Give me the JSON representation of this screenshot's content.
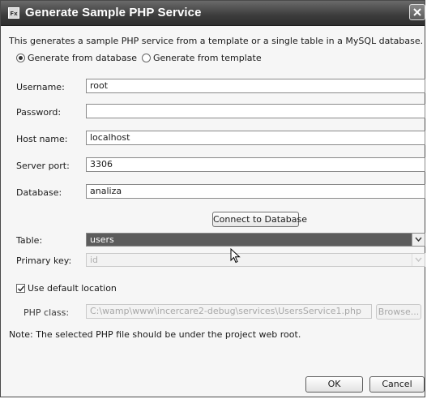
{
  "window": {
    "title": "Generate Sample PHP Service",
    "app_icon_text": "Fx"
  },
  "description": "This generates a sample PHP service from a template or a single table in a MySQL database.",
  "source_options": [
    {
      "label": "Generate from database",
      "selected": true
    },
    {
      "label": "Generate from template",
      "selected": false
    }
  ],
  "form": {
    "username": {
      "label": "Username:",
      "value": "root"
    },
    "password": {
      "label": "Password:",
      "value": ""
    },
    "host": {
      "label": "Host name:",
      "value": "localhost"
    },
    "port": {
      "label": "Server port:",
      "value": "3306"
    },
    "database": {
      "label": "Database:",
      "value": "analiza"
    }
  },
  "connect_button": "Connect to Database",
  "table": {
    "label": "Table:",
    "value": "users"
  },
  "primary_key": {
    "label": "Primary key:",
    "value": "id"
  },
  "use_default_location": {
    "label": "Use default location",
    "checked": true
  },
  "php_class": {
    "label": "PHP class:",
    "value": "C:\\wamp\\www\\incercare2-debug\\services\\UsersService1.php",
    "browse_label": "Browse..."
  },
  "note": "Note: The selected PHP file should be under the project web root.",
  "buttons": {
    "ok": "OK",
    "cancel": "Cancel"
  }
}
